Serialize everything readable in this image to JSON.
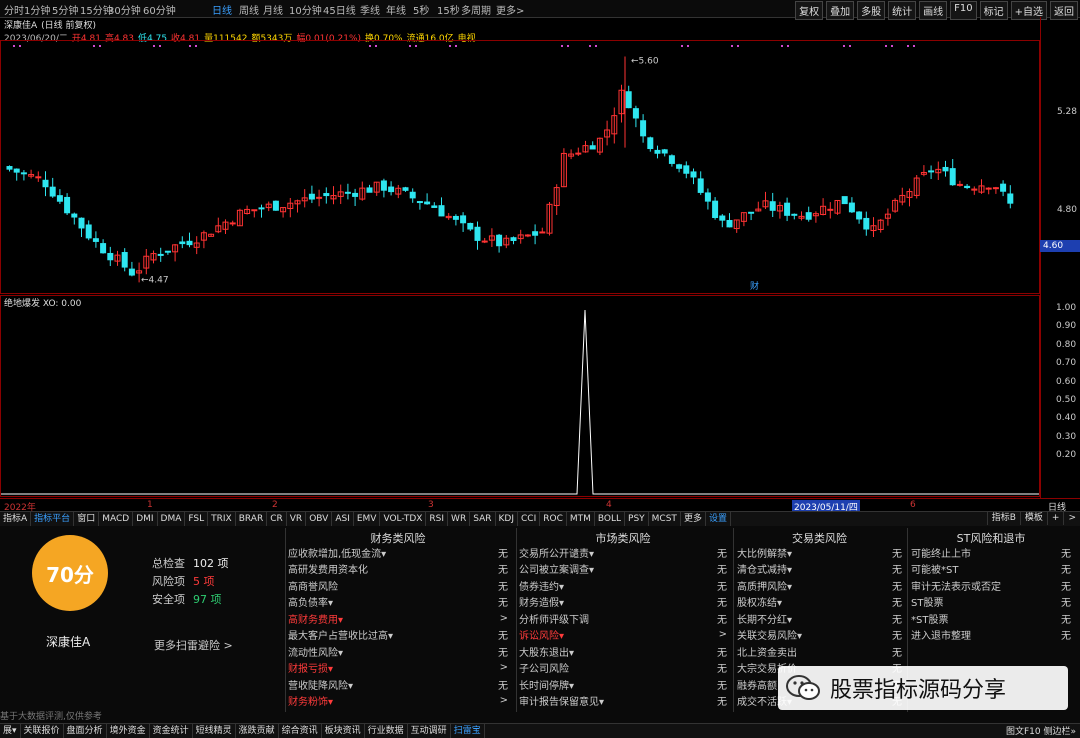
{
  "toolbar": {
    "timeframes": [
      "分时",
      "1分钟",
      "5分钟",
      "15分钟",
      "30分钟",
      "60分钟",
      "日线",
      "周线",
      "月线",
      "10分钟",
      "45日线",
      "季线",
      "年线",
      "5秒",
      "15秒",
      "多周期",
      "更多>"
    ],
    "active_timeframe": "日线",
    "tools": [
      "复权",
      "叠加",
      "多股",
      "统计",
      "画线",
      "F10",
      "标记",
      "+自选",
      "返回"
    ]
  },
  "info": {
    "name": "深康佳A",
    "mode": "(日线 前复权)",
    "date": "2023/06/20/二",
    "open": "开4.81",
    "high": "高4.83",
    "low": "低4.75",
    "close": "收4.81",
    "volume": "量111542",
    "amount": "额5343万",
    "change": "幅0.01(0.21%)",
    "turnover": "换0.70%",
    "float": "流通16.0亿",
    "tv": "电视"
  },
  "price_axis": [
    "5.28",
    "4.80"
  ],
  "current_price": "4.60",
  "high_marker": "5.60",
  "low_marker": "4.47",
  "fin_marker": "财",
  "indicator": {
    "label": "绝地爆发",
    "xo": "XO: 0.00",
    "ticks": [
      "1.00",
      "0.90",
      "0.80",
      "0.70",
      "0.60",
      "0.50",
      "0.40",
      "0.30",
      "0.20"
    ]
  },
  "time_axis": [
    "2022年",
    "1",
    "2",
    "3",
    "4",
    "2023/05/11/四",
    "6",
    "日线"
  ],
  "indicator_tabs": [
    "指标A",
    "指标平台",
    "窗口",
    "MACD",
    "DMI",
    "DMA",
    "FSL",
    "TRIX",
    "BRAR",
    "CR",
    "VR",
    "OBV",
    "ASI",
    "EMV",
    "VOL-TDX",
    "RSI",
    "WR",
    "SAR",
    "KDJ",
    "CCI",
    "ROC",
    "MTM",
    "BOLL",
    "PSY",
    "MCST",
    "更多",
    "设置"
  ],
  "indicator_tabs_right": [
    "指标B",
    "模板",
    "+",
    ">"
  ],
  "risk": {
    "score": "70分",
    "stock": "深康佳A",
    "total_label": "总检查",
    "total": "102 项",
    "risk_label": "风险项",
    "risk_count": "5 项",
    "safe_label": "安全项",
    "safe_count": "97 项",
    "more": "更多扫雷避险 >",
    "disclaimer": "基于大数据评测,仅供参考",
    "columns": [
      {
        "title": "财务类风险",
        "rows": [
          {
            "label": "应收款增加,低现金流▾",
            "value": "无",
            "red": false
          },
          {
            "label": "高研发费用资本化",
            "value": "无",
            "red": false
          },
          {
            "label": "高商誉风险",
            "value": "无",
            "red": false
          },
          {
            "label": "高负债率▾",
            "value": "无",
            "red": false
          },
          {
            "label": "高财务费用▾",
            "value": ">",
            "red": true
          },
          {
            "label": "最大客户占营收比过高▾",
            "value": "无",
            "red": false
          },
          {
            "label": "流动性风险▾",
            "value": "无",
            "red": false
          },
          {
            "label": "财报亏损▾",
            "value": ">",
            "red": true
          },
          {
            "label": "营收陡降风险▾",
            "value": "无",
            "red": false
          },
          {
            "label": "财务粉饰▾",
            "value": ">",
            "red": true
          }
        ]
      },
      {
        "title": "市场类风险",
        "rows": [
          {
            "label": "交易所公开谴责▾",
            "value": "无",
            "red": false
          },
          {
            "label": "公司被立案调查▾",
            "value": "无",
            "red": false
          },
          {
            "label": "债券违约▾",
            "value": "无",
            "red": false
          },
          {
            "label": "财务造假▾",
            "value": "无",
            "red": false
          },
          {
            "label": "分析师评级下调",
            "value": "无",
            "red": false
          },
          {
            "label": "诉讼风险▾",
            "value": ">",
            "red": true
          },
          {
            "label": "大股东退出▾",
            "value": "无",
            "red": false
          },
          {
            "label": "子公司风险",
            "value": "无",
            "red": false
          },
          {
            "label": "长时间停牌▾",
            "value": "无",
            "red": false
          },
          {
            "label": "审计报告保留意见▾",
            "value": "无",
            "red": false
          }
        ]
      },
      {
        "title": "交易类风险",
        "rows": [
          {
            "label": "大比例解禁▾",
            "value": "无",
            "red": false
          },
          {
            "label": "清仓式减持▾",
            "value": "无",
            "red": false
          },
          {
            "label": "高质押风险▾",
            "value": "无",
            "red": false
          },
          {
            "label": "股权冻结▾",
            "value": "无",
            "red": false
          },
          {
            "label": "长期不分红▾",
            "value": "无",
            "red": false
          },
          {
            "label": "关联交易风险▾",
            "value": "无",
            "red": false
          },
          {
            "label": "北上资金卖出",
            "value": "无",
            "red": false
          },
          {
            "label": "大宗交易折价",
            "value": "无",
            "red": false
          },
          {
            "label": "融券高额",
            "value": "无",
            "red": false
          },
          {
            "label": "成交不活跃▾",
            "value": "无",
            "red": false
          }
        ]
      },
      {
        "title": "ST风险和退市",
        "rows": [
          {
            "label": "可能终止上市",
            "value": "无",
            "red": false
          },
          {
            "label": "可能被*ST",
            "value": "无",
            "red": false
          },
          {
            "label": "审计无法表示或否定",
            "value": "无",
            "red": false
          },
          {
            "label": "ST股票",
            "value": "无",
            "red": false
          },
          {
            "label": "*ST股票",
            "value": "无",
            "red": false
          },
          {
            "label": "进入退市整理",
            "value": "无",
            "red": false
          }
        ]
      }
    ]
  },
  "status_bar": [
    "展▾",
    "关联报价",
    "盘面分析",
    "境外资金",
    "资金统计",
    "短线精灵",
    "涨跌贡献",
    "综合资讯",
    "板块资讯",
    "行业数据",
    "互动调研",
    "扫雷宝"
  ],
  "status_active": "扫雷宝",
  "status_right": "图文F10 侧边栏»",
  "watermark": "股票指标源码分享",
  "colors": {
    "up": "#ff3333",
    "down": "#2ee6f0",
    "frame": "#8b0000",
    "accent": "#3aa0ff",
    "score": "#f5a623"
  }
}
